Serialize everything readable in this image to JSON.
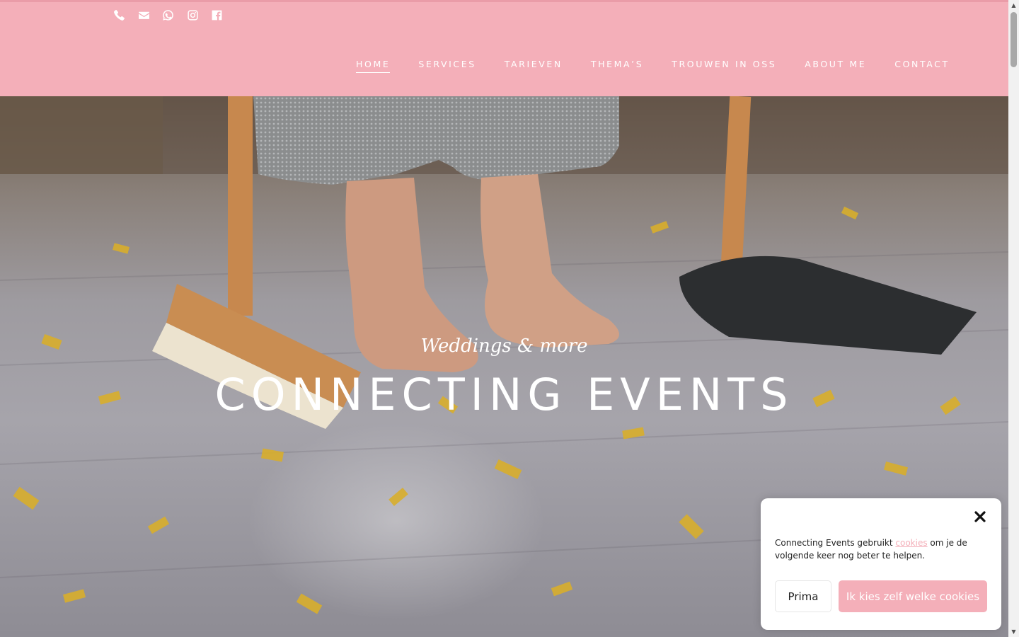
{
  "header": {
    "social_icons": [
      "phone-icon",
      "envelope-icon",
      "whatsapp-icon",
      "instagram-icon",
      "facebook-icon"
    ],
    "nav": [
      {
        "label": "HOME",
        "active": true
      },
      {
        "label": "SERVICES",
        "active": false
      },
      {
        "label": "TARIEVEN",
        "active": false
      },
      {
        "label": "THEMA’S",
        "active": false
      },
      {
        "label": "TROUWEN IN OSS",
        "active": false
      },
      {
        "label": "ABOUT ME",
        "active": false
      },
      {
        "label": "CONTACT",
        "active": false
      }
    ]
  },
  "hero": {
    "tagline": "Weddings & more",
    "title": "CONNECTING EVENTS"
  },
  "cookie": {
    "text_before": "Connecting Events gebruikt ",
    "link": "cookies",
    "text_after": " om je de volgende keer nog beter te helpen.",
    "accept_label": "Prima",
    "choose_label": "Ik kies zelf welke cookies"
  },
  "colors": {
    "brand_pink": "#f4afb9",
    "white": "#ffffff"
  }
}
